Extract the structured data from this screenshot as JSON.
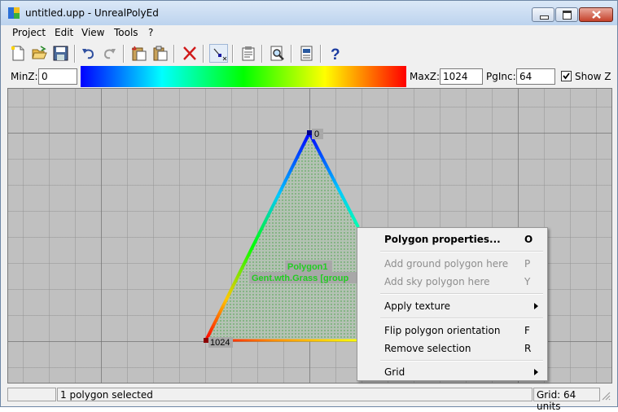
{
  "window": {
    "title": "untitled.upp - UnrealPolyEd"
  },
  "menubar": {
    "items": [
      {
        "label": "Project"
      },
      {
        "label": "Edit"
      },
      {
        "label": "View"
      },
      {
        "label": "Tools"
      },
      {
        "label": "?"
      }
    ]
  },
  "toolbar": {
    "icons": [
      "new-file-icon",
      "open-folder-icon",
      "save-icon",
      "undo-icon",
      "redo-icon",
      "paste-special-icon",
      "paste-icon",
      "delete-icon",
      "select-point-icon",
      "properties-icon",
      "zoom-preview-icon",
      "document-icon",
      "help-icon"
    ]
  },
  "zbar": {
    "minz_label": "MinZ:",
    "minz_value": "0",
    "maxz_label": "MaxZ:",
    "maxz_value": "1024",
    "pginc_label": "PgInc:",
    "pginc_value": "64",
    "showz_label": "Show Z",
    "showz_checked": true
  },
  "canvas": {
    "vertex_top_label": "0",
    "vertex_bottom_label": "1024",
    "polygon_name": "Polygon1",
    "polygon_texture": "Gent.wth.Grass [group"
  },
  "context_menu": {
    "items": [
      {
        "label": "Polygon properties...",
        "key": "O",
        "enabled": true,
        "bold": true
      },
      {
        "label": "Add ground polygon here",
        "key": "P",
        "enabled": false
      },
      {
        "label": "Add sky polygon here",
        "key": "Y",
        "enabled": false
      },
      {
        "label": "Apply texture",
        "key": "",
        "enabled": true,
        "submenu": true
      },
      {
        "label": "Flip polygon orientation",
        "key": "F",
        "enabled": true
      },
      {
        "label": "Remove selection",
        "key": "R",
        "enabled": true
      },
      {
        "label": "Grid",
        "key": "",
        "enabled": true,
        "submenu": true
      }
    ]
  },
  "statusbar": {
    "selection_text": "1 polygon selected",
    "grid_text": "Grid: 64 units"
  }
}
